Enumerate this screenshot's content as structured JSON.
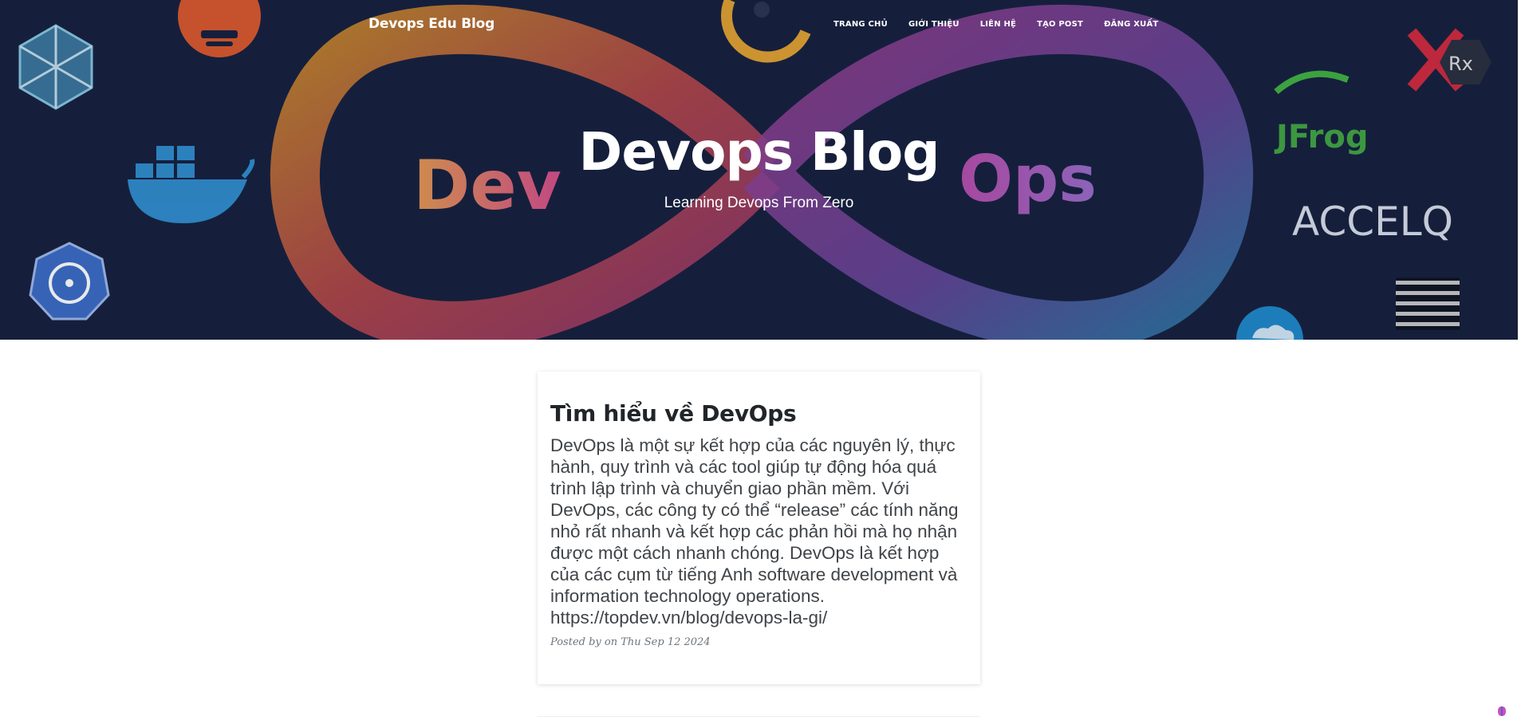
{
  "nav": {
    "brand": "Devops Edu Blog",
    "links": [
      "TRANG CHỦ",
      "GIỚI THIỆU",
      "LIÊN HỆ",
      "TẠO POST",
      "ĐĂNG XUẤT"
    ]
  },
  "hero": {
    "title": "Devops Blog",
    "subtitle": "Learning Devops From Zero",
    "background_word_left": "Dev",
    "background_word_right": "Ops",
    "logo_jfrog": "JFrog",
    "logo_accelq": "ACCELQ",
    "logo_rx": "Rx"
  },
  "post": {
    "title": "Tìm hiểu về DevOps",
    "excerpt": "DevOps là một sự kết hợp của các nguyên lý, thực hành, quy trình và các tool giúp tự động hóa quá trình lập trình và chuyển giao phần mềm. Với DevOps, các công ty có thể “release” các tính năng nhỏ rất nhanh và kết hợp các phản hồi mà họ nhận được một cách nhanh chóng. DevOps là kết hợp của các cụm từ tiếng Anh software development và information technology operations. https://topdev.vn/blog/devops-la-gi/",
    "meta": "Posted by on Thu Sep 12 2024"
  },
  "colors": {
    "hero_bg": "#151f3d",
    "text_dark": "#212529",
    "meta_gray": "#6c757d"
  }
}
